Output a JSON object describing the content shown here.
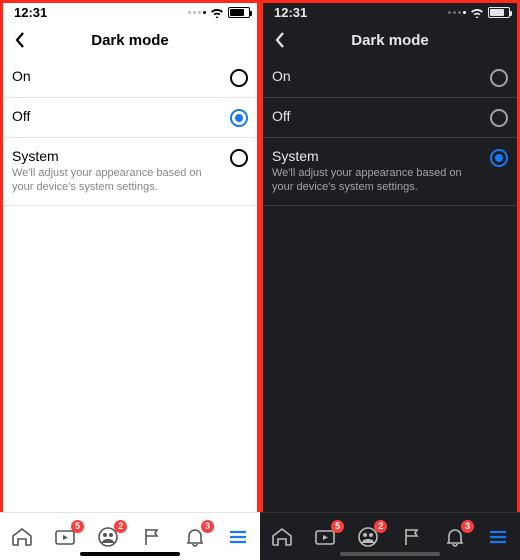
{
  "status": {
    "time": "12:31"
  },
  "header": {
    "title": "Dark mode"
  },
  "options": {
    "on": {
      "label": "On",
      "subtitle": ""
    },
    "off": {
      "label": "Off",
      "subtitle": ""
    },
    "system": {
      "label": "System",
      "subtitle": "We'll adjust your appearance based on your device's system settings."
    }
  },
  "light_selected": "off",
  "dark_selected": "system",
  "badges": {
    "watch": "5",
    "groups": "2",
    "notifications": "3"
  },
  "colors": {
    "accent": "#1877f2",
    "highlight": "#ff2a1a"
  }
}
